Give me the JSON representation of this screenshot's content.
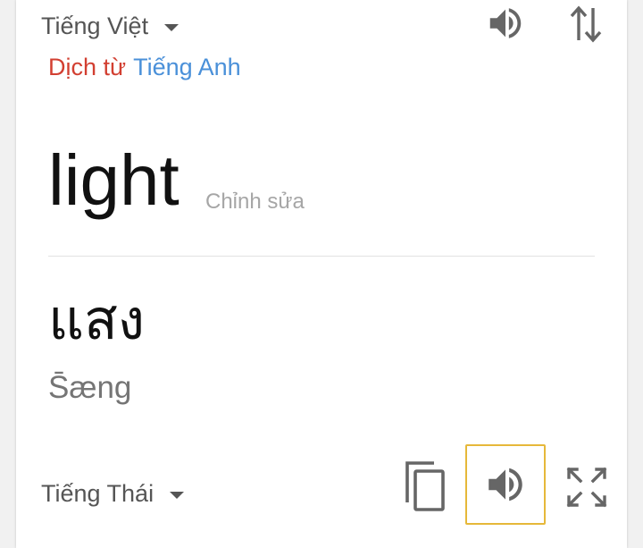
{
  "source": {
    "language": "Tiếng Việt",
    "detected_label": "Dịch từ",
    "detected_language": "Tiếng Anh",
    "word": "light",
    "edit_label": "Chỉnh sửa"
  },
  "target": {
    "language": "Tiếng Thái",
    "translation": "แสง",
    "romanization": "S̄æng"
  },
  "icons": {
    "source_speak": "volume-icon",
    "swap": "swap-languages-icon",
    "copy": "copy-icon",
    "target_speak": "volume-icon",
    "fullscreen": "fullscreen-icon"
  },
  "colors": {
    "detected_label": "#d23f31",
    "detected_language": "#4a90d9",
    "focus_border": "#e6b83a"
  }
}
